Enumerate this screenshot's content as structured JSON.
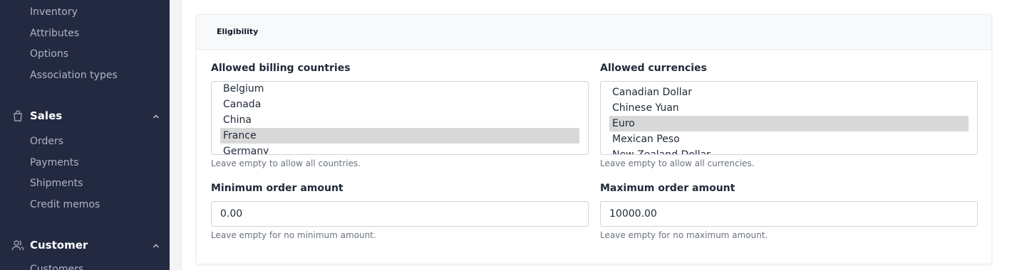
{
  "sidebar": {
    "catalog_items": [
      {
        "label": "Inventory"
      },
      {
        "label": "Attributes"
      },
      {
        "label": "Options"
      },
      {
        "label": "Association types"
      }
    ],
    "sales": {
      "label": "Sales",
      "icon": "shopping-bag-icon",
      "items": [
        {
          "label": "Orders"
        },
        {
          "label": "Payments"
        },
        {
          "label": "Shipments"
        },
        {
          "label": "Credit memos"
        }
      ]
    },
    "customer": {
      "label": "Customer",
      "icon": "users-icon",
      "items": [
        {
          "label": "Customers"
        }
      ]
    }
  },
  "card": {
    "title": "Eligibility",
    "billing_countries": {
      "label": "Allowed billing countries",
      "options": [
        "Belgium",
        "Canada",
        "China",
        "France",
        "Germany"
      ],
      "selected": "France",
      "hint": "Leave empty to allow all countries."
    },
    "currencies": {
      "label": "Allowed currencies",
      "options": [
        "Canadian Dollar",
        "Chinese Yuan",
        "Euro",
        "Mexican Peso",
        "New Zealand Dollar"
      ],
      "selected": "Euro",
      "hint": "Leave empty to allow all currencies."
    },
    "min_order": {
      "label": "Minimum order amount",
      "value": "0.00",
      "hint": "Leave empty for no minimum amount."
    },
    "max_order": {
      "label": "Maximum order amount",
      "value": "10000.00",
      "hint": "Leave empty for no maximum amount."
    }
  },
  "colors": {
    "sidebar_bg": "#232940",
    "selected_option_bg": "#d8d8d8"
  }
}
